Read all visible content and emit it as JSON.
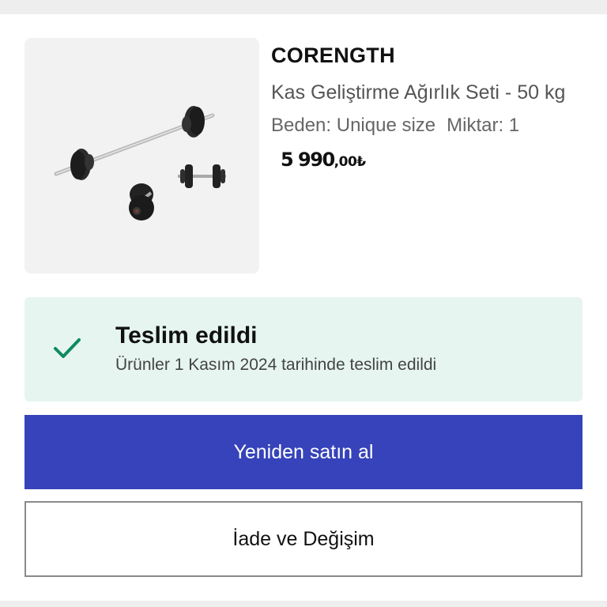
{
  "product": {
    "brand": "CORENGTH",
    "name": "Kas Geliştirme Ağırlık Seti - 50 kg",
    "size_label": "Beden: Unique size",
    "quantity_label": "Miktar: 1",
    "price_main": "5 990",
    "price_cents": ",00₺",
    "image_icon": "barbell-dumbbell-set-image"
  },
  "status": {
    "icon": "check-icon",
    "title": "Teslim edildi",
    "subtitle": "Ürünler 1 Kasım 2024 tarihinde teslim edildi",
    "color": "#0f8a5f",
    "background": "#e6f5ef"
  },
  "actions": {
    "rebuy_label": "Yeniden satın al",
    "return_label": "İade ve Değişim",
    "primary_color": "#3643ba"
  }
}
